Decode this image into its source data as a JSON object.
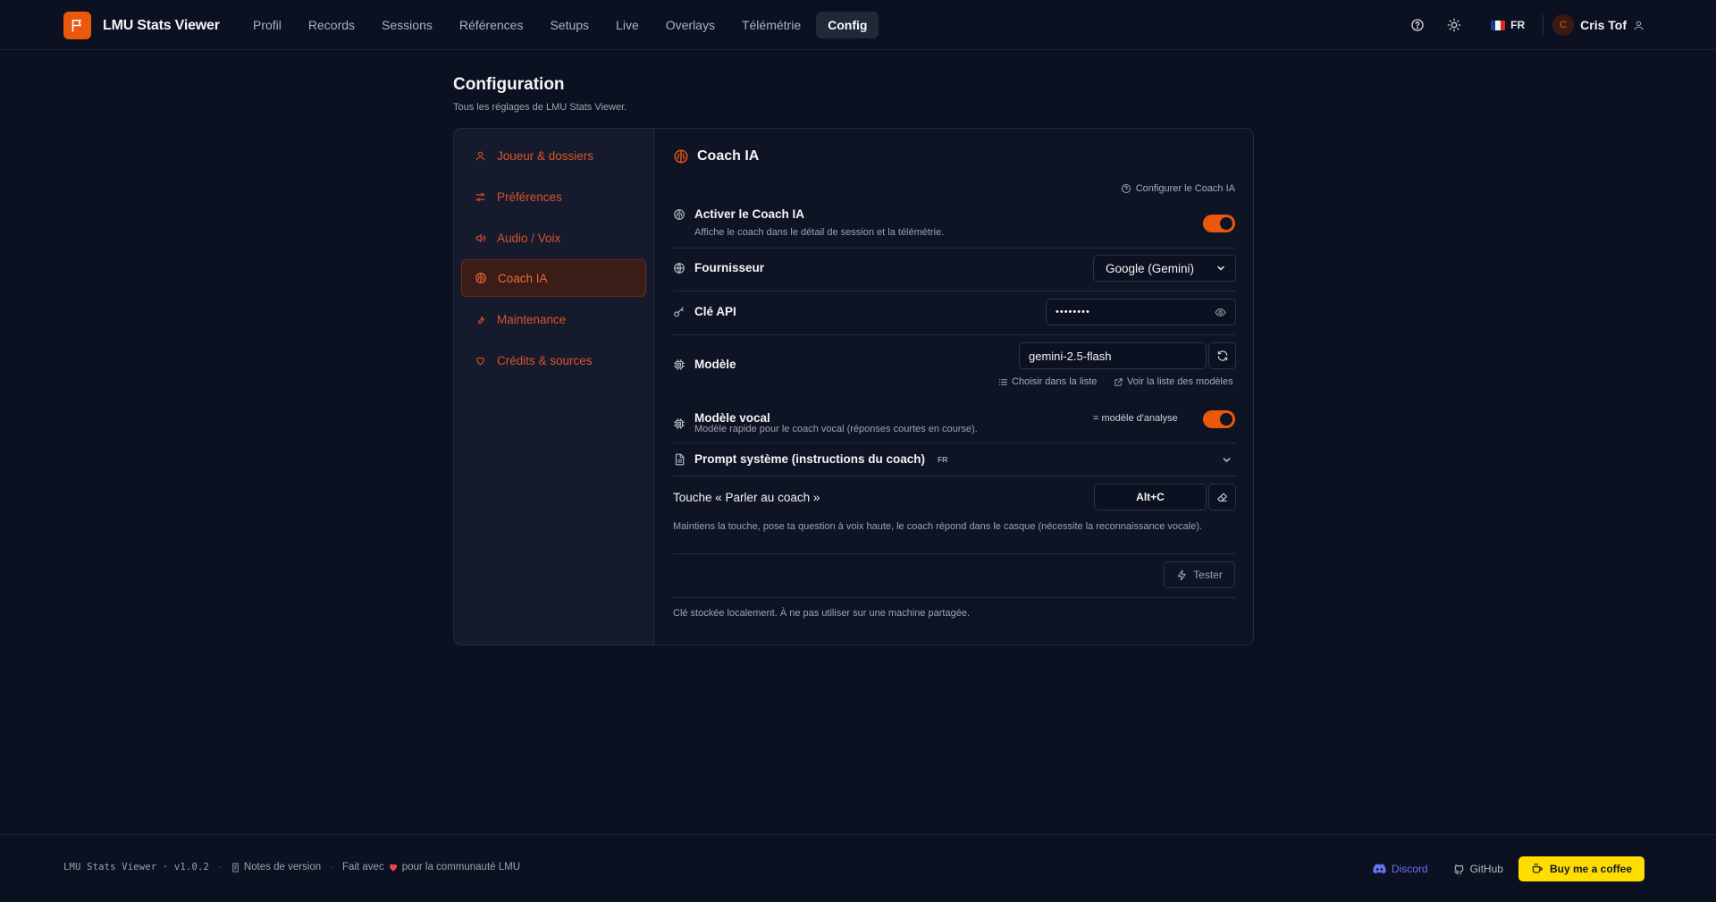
{
  "header": {
    "app_title": "LMU Stats Viewer",
    "nav": [
      "Profil",
      "Records",
      "Sessions",
      "Références",
      "Setups",
      "Live",
      "Overlays",
      "Télémétrie",
      "Config"
    ],
    "active_nav": "Config",
    "language": "FR",
    "user_initial": "C",
    "user_name": "Cris Tof"
  },
  "page": {
    "title": "Configuration",
    "subtitle": "Tous les réglages de LMU Stats Viewer."
  },
  "sidebar": {
    "items": [
      {
        "label": "Joueur & dossiers",
        "icon": "user-icon"
      },
      {
        "label": "Préférences",
        "icon": "sliders-icon"
      },
      {
        "label": "Audio / Voix",
        "icon": "speaker-icon"
      },
      {
        "label": "Coach IA",
        "icon": "brain-icon",
        "active": true
      },
      {
        "label": "Maintenance",
        "icon": "wrench-icon"
      },
      {
        "label": "Crédits & sources",
        "icon": "heart-icon"
      }
    ]
  },
  "coach": {
    "title": "Coach IA",
    "help_link": "Configurer le Coach IA",
    "enable": {
      "label": "Activer le Coach IA",
      "desc": "Affiche le coach dans le détail de session et la télémétrie.",
      "on": true
    },
    "provider": {
      "label": "Fournisseur",
      "value": "Google (Gemini)"
    },
    "api_key": {
      "label": "Clé API",
      "value": "••••••••"
    },
    "model": {
      "label": "Modèle",
      "value": "gemini-2.5-flash",
      "choose_link": "Choisir dans la liste",
      "view_link": "Voir la liste des modèles"
    },
    "voice_model": {
      "label": "Modèle vocal",
      "desc": "Modèle rapide pour le coach vocal (réponses courtes en course).",
      "same_label": "= modèle d'analyse",
      "on": true
    },
    "prompt": {
      "label": "Prompt système (instructions du coach)",
      "tag": "FR"
    },
    "hotkey": {
      "label": "Touche « Parler au coach »",
      "value": "Alt+C",
      "desc": "Maintiens la touche, pose ta question à voix haute, le coach répond dans le casque (nécessite la reconnaissance vocale)."
    },
    "test_button": "Tester",
    "storage_note": "Clé stockée localement. À ne pas utiliser sur une machine partagée."
  },
  "footer": {
    "version": "LMU Stats Viewer · v1.0.2",
    "release_notes": "Notes de version",
    "made_with_prefix": "Fait avec",
    "made_with_suffix": "pour la communauté LMU",
    "discord": "Discord",
    "github": "GitHub",
    "coffee": "Buy me a coffee"
  },
  "colors": {
    "accent": "#ea580c",
    "background": "#0b1120",
    "coffee": "#ffdd00",
    "discord": "#6574f2"
  }
}
